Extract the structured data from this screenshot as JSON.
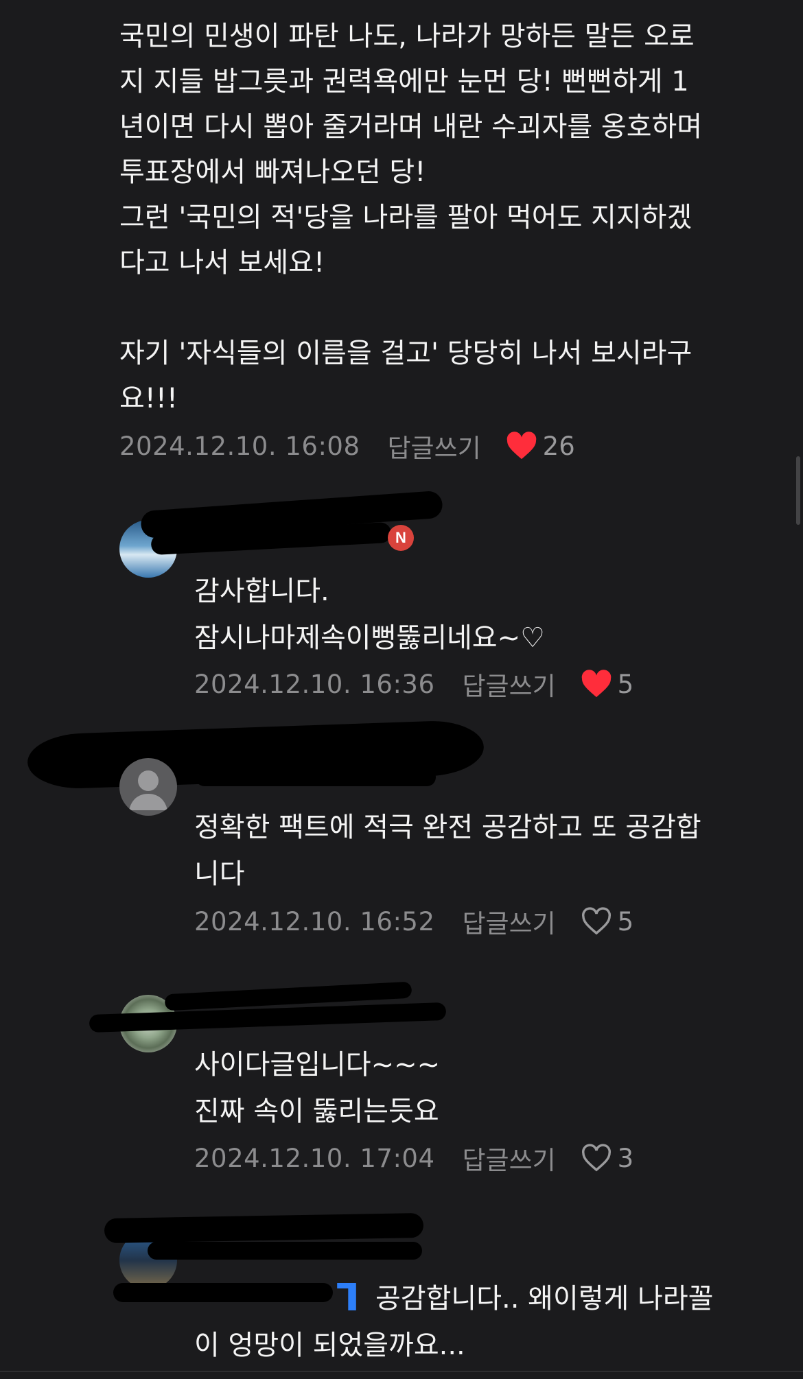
{
  "post": {
    "lines": [
      "국민의 민생이 파탄 나도, 나라가 망하든 말든 오로",
      "지 지들 밥그릇과 권력욕에만 눈먼 당! 뻔뻔하게 1",
      "년이면 다시 뽑아 줄거라며 내란 수괴자를 옹호하며",
      "투표장에서 빠져나오던 당!",
      "그런 '국민의 적'당을 나라를 팔아 먹어도 지지하겠",
      "다고 나서 보세요!",
      "",
      "자기 '자식들의 이름을 걸고' 당당히 나서 보시라구",
      "요!!!"
    ],
    "date": "2024.12.10. 16:08",
    "reply_label": "답글쓰기",
    "likes": "26",
    "liked": true
  },
  "replies": [
    {
      "badge": "N",
      "lines": [
        "감사합니다.",
        "잠시나마제속이뻥뚫리네요~♡"
      ],
      "date": "2024.12.10. 16:36",
      "reply_label": "답글쓰기",
      "likes": "5",
      "liked": true
    },
    {
      "lines": [
        "정확한 팩트에 적극 완전 공감하고 또 공감합",
        "니다"
      ],
      "date": "2024.12.10. 16:52",
      "reply_label": "답글쓰기",
      "likes": "5",
      "liked": false
    },
    {
      "lines": [
        "사이다글입니다~~~",
        "진짜 속이 뚫리는듯요"
      ],
      "date": "2024.12.10. 17:04",
      "reply_label": "답글쓰기",
      "likes": "3",
      "liked": false
    },
    {
      "lines": [
        "공감합니다.. 왜이렇게 나라꼴",
        "이 엉망이 되었을까요..."
      ]
    }
  ],
  "colors": {
    "background": "#1b1b1d",
    "text": "#f4f4f4",
    "meta": "#8c8c8e",
    "heart_filled": "#ff2d3b",
    "badge": "#d9433c",
    "mention": "#2d7ff9"
  }
}
